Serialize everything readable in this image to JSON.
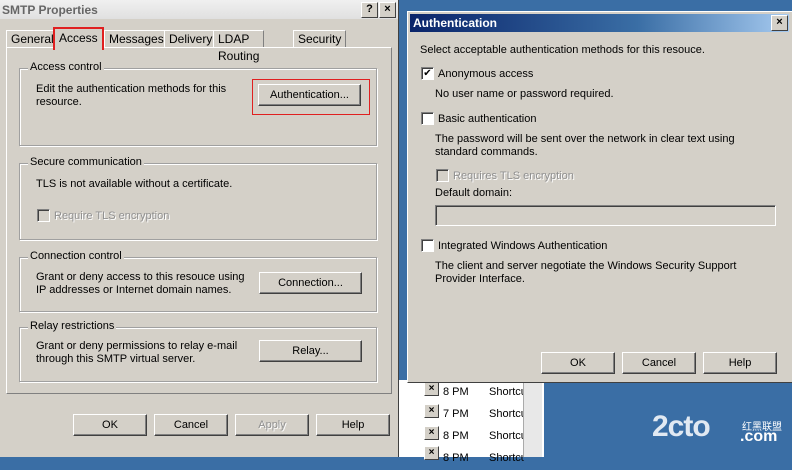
{
  "background_list": {
    "rows": [
      {
        "time": "8 PM",
        "name": "Shortcu"
      },
      {
        "time": "7 PM",
        "name": "Shortcu"
      },
      {
        "time": "8 PM",
        "name": "Shortcu"
      },
      {
        "time": "8 PM",
        "name": "Shortcu"
      }
    ],
    "close_glyph": "×"
  },
  "smtp_window": {
    "title": "SMTP Properties",
    "help_glyph": "?",
    "close_glyph": "×",
    "tabs": [
      "General",
      "Access",
      "Messages",
      "Delivery",
      "LDAP Routing",
      "Security"
    ],
    "active_tab": "Access",
    "access_control": {
      "title": "Access control",
      "description": "Edit the authentication methods for this resource.",
      "button": "Authentication..."
    },
    "secure_communication": {
      "title": "Secure communication",
      "description": "TLS is not available without a certificate.",
      "checkbox": "Require TLS encryption"
    },
    "connection_control": {
      "title": "Connection control",
      "description": "Grant or deny access to this resouce using IP addresses or Internet domain names.",
      "button": "Connection..."
    },
    "relay_restrictions": {
      "title": "Relay restrictions",
      "description": "Grant or deny permissions to relay e-mail through this SMTP virtual server.",
      "button": "Relay..."
    },
    "buttons": {
      "ok": "OK",
      "cancel": "Cancel",
      "apply": "Apply",
      "help": "Help"
    }
  },
  "auth_window": {
    "title": "Authentication",
    "close_glyph": "×",
    "intro": "Select acceptable authentication methods for this resouce.",
    "anonymous": {
      "label": "Anonymous access",
      "checked": true,
      "check_glyph": "✔",
      "description": "No user name or password required."
    },
    "basic": {
      "label": "Basic authentication",
      "checked": false,
      "description": "The password will be sent over the network in clear text using standard commands.",
      "tls_label": "Requires TLS encryption",
      "domain_label": "Default domain:",
      "domain_value": ""
    },
    "integrated": {
      "label": "Integrated Windows Authentication",
      "checked": false,
      "description": "The client and server negotiate the Windows Security Support Provider Interface."
    },
    "buttons": {
      "ok": "OK",
      "cancel": "Cancel",
      "help": "Help"
    }
  },
  "watermark": {
    "logo": "2cto",
    "line1": "红黑联盟",
    "line2": ".com"
  }
}
